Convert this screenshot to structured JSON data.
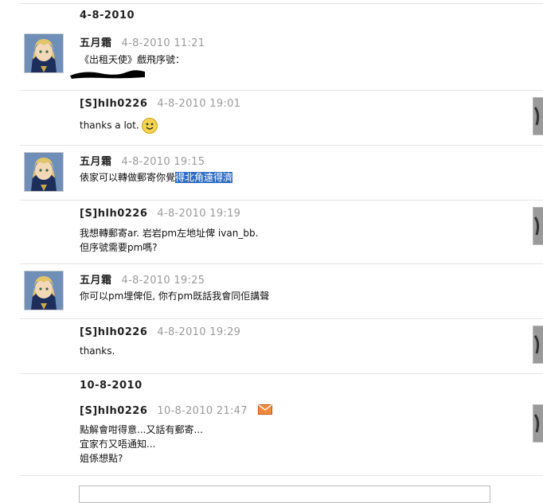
{
  "groups": [
    {
      "date": "4-8-2010"
    },
    {
      "date": "10-8-2010"
    }
  ],
  "messages": [
    {
      "author": "五月霜",
      "time": "4-8-2010 11:21",
      "lines": [
        "《出租天使》戲飛序號："
      ],
      "side": "left"
    },
    {
      "author": "[S]hlh0226",
      "time": "4-8-2010 19:01",
      "lines": [
        "thanks a lot."
      ],
      "side": "right"
    },
    {
      "author": "五月霜",
      "time": "4-8-2010 19:15",
      "lines": [
        "俵家可以轉做郵寄你覺"
      ],
      "selected": "得北角遠得濟",
      "side": "left"
    },
    {
      "author": "[S]hlh0226",
      "time": "4-8-2010 19:19",
      "lines": [
        "我想轉郵寄ar. 岩岩pm左地址俾 ivan_bb.",
        "但序號需要pm嗎?"
      ],
      "side": "right"
    },
    {
      "author": "五月霜",
      "time": "4-8-2010 19:25",
      "lines": [
        "你可以pm埋俾佢, 你冇pm既話我會同佢講聲"
      ],
      "side": "left"
    },
    {
      "author": "[S]hlh0226",
      "time": "4-8-2010 19:29",
      "lines": [
        "thanks."
      ],
      "side": "right"
    },
    {
      "author": "[S]hlh0226",
      "time": "10-8-2010 21:47",
      "lines": [
        "點解會咁得意...又話有郵寄...",
        "宜家冇又唔通知...",
        "姐係想點?"
      ],
      "side": "right"
    }
  ],
  "icons": {
    "smiley": "smiley-icon",
    "mail": "envelope-icon",
    "avatar_left": "saber-avatar",
    "avatar_right": "user-avatar"
  },
  "colors": {
    "selection": "#2f6ec4",
    "time": "#9a9a9a",
    "mail_icon": "#e86a1a"
  }
}
